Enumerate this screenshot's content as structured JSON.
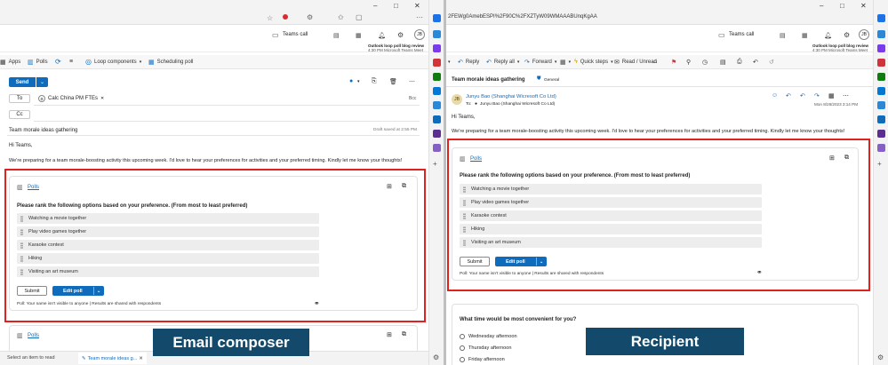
{
  "composer": {
    "ribbon": {
      "apps": "Apps",
      "polls": "Polls",
      "loop": "Loop components",
      "scheduling": "Scheduling poll"
    },
    "teams_call": "Teams call",
    "notification": {
      "title": "Outlook loop poll blog review",
      "time": "4:30 PM Microsoft Teams Meet"
    },
    "send": "Send",
    "to_label": "To",
    "cc_label": "Cc",
    "bcc_label": "Bcc",
    "recipient_chip": "Calc China PM FTEs",
    "subject": "Team morale ideas gathering",
    "draft_saved": "Draft saved at 2:55 PM",
    "greeting": "Hi Teams,",
    "body": "We're preparing for a team morale-boosting activity this upcoming week. I'd love to hear your preferences for activities and your preferred timing. Kindly let me know your thoughts!",
    "status_left": "Select an item to read",
    "status_tab": "Team morale ideas g...",
    "second_polls": "Polls"
  },
  "recipient": {
    "url": "2FEWg0AmebESPI%2F90C%2FXZTyW09WMAAABUnqKgAA",
    "ribbon": {
      "reply": "Reply",
      "reply_all": "Reply all",
      "forward": "Forward",
      "quick_steps": "Quick steps",
      "read_unread": "Read / Unread"
    },
    "teams_call": "Teams call",
    "notification": {
      "title": "Outlook loop poll blog review",
      "time": "4:30 PM Microsoft Teams Meet"
    },
    "subject": "Team morale ideas gathering",
    "sensitivity": "General",
    "sender": "Junyu Bao (Shanghai Wicresoft Co Ltd)",
    "to_prefix": "To:",
    "to_name": "Junyu Bao (Shanghai Wicresoft Co Ltd)",
    "date": "Mon 8/28/2023 3:14 PM",
    "greeting": "Hi Teams,",
    "body": "We're preparing for a team morale-boosting activity this upcoming week. I'd love to hear your preferences for activities and your preferred timing. Kindly let me know your thoughts!",
    "second_poll": {
      "question": "What time would be most convenient for you?",
      "options": [
        "Wednesday afternoon",
        "Thursday afternoon",
        "Friday afternoon"
      ]
    }
  },
  "poll": {
    "label": "Polls",
    "question": "Please rank the following options based on your preference. (From most to least preferred)",
    "options": [
      "Watching a movie together",
      "Play video games together",
      "Karaoke contest",
      "Hiking",
      "Visiting an art museum"
    ],
    "submit": "Submit",
    "edit": "Edit poll",
    "footer": "Poll: Your name isn't visible to anyone | Results are shared with respondents"
  },
  "banners": {
    "left": "Email composer",
    "right": "Recipient"
  },
  "colors": {
    "highlight": "#e0211f",
    "banner": "#134a6b",
    "accent": "#0f6cbd"
  }
}
